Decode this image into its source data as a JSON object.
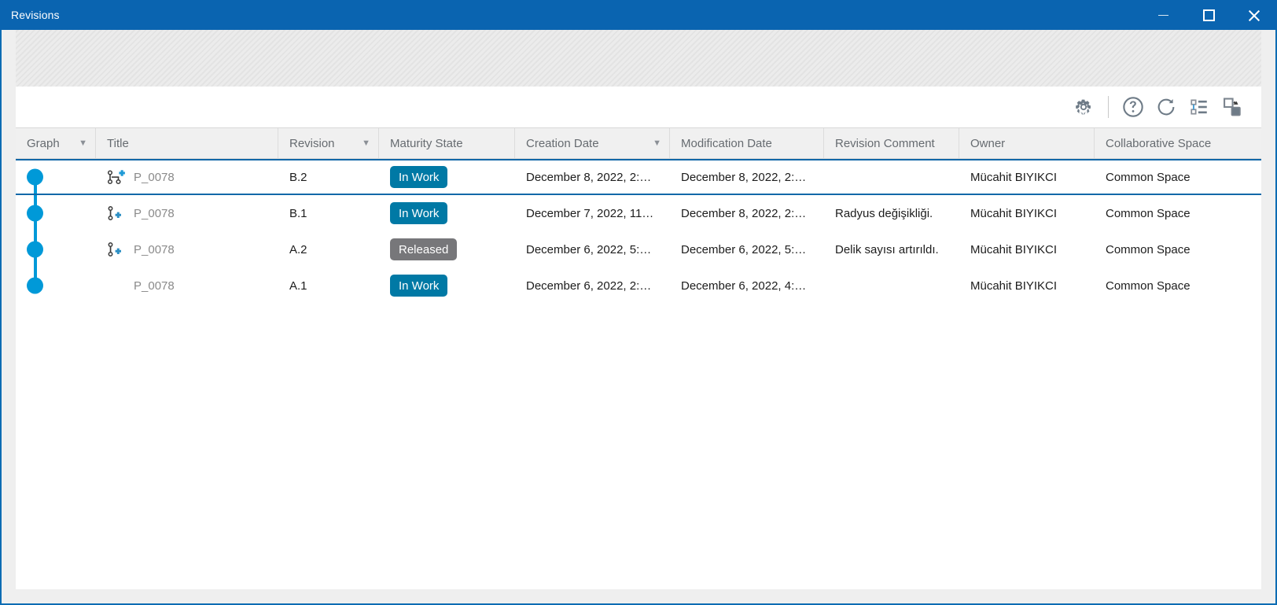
{
  "window": {
    "title": "Revisions",
    "controls": {
      "minimize": "minimize-button",
      "maximize": "maximize-button",
      "close": "close-button"
    },
    "accent_color": "#0a64b0",
    "selection_border_color": "#1268a8"
  },
  "toolbar": {
    "buttons": [
      {
        "name": "settings-icon",
        "tooltip": "Settings"
      },
      {
        "name": "help-icon",
        "tooltip": "Help"
      },
      {
        "name": "refresh-icon",
        "tooltip": "Refresh"
      },
      {
        "name": "tree-list-icon",
        "tooltip": "Tree View"
      },
      {
        "name": "restore-down-icon",
        "tooltip": "Restore Down"
      }
    ]
  },
  "table": {
    "columns": [
      {
        "key": "graph",
        "label": "Graph",
        "sort": "▼"
      },
      {
        "key": "title",
        "label": "Title",
        "sort": ""
      },
      {
        "key": "revision",
        "label": "Revision",
        "sort": "▼"
      },
      {
        "key": "maturity",
        "label": "Maturity State",
        "sort": ""
      },
      {
        "key": "created",
        "label": "Creation Date",
        "sort": "▼"
      },
      {
        "key": "modified",
        "label": "Modification Date",
        "sort": ""
      },
      {
        "key": "comment",
        "label": "Revision Comment",
        "sort": ""
      },
      {
        "key": "owner",
        "label": "Owner",
        "sort": ""
      },
      {
        "key": "space",
        "label": "Collaborative Space",
        "sort": ""
      }
    ],
    "rows": [
      {
        "selected": true,
        "graph": {
          "dot": true,
          "line_up": false,
          "line_down": true
        },
        "icon": "revision-branch-add-icon",
        "title": "P_0078",
        "revision": "B.2",
        "maturity": "In Work",
        "maturity_style": "inwork",
        "created": "December 8, 2022, 2:…",
        "modified": "December 8, 2022, 2:…",
        "comment": "",
        "owner": "Mücahit BIYIKCI",
        "space": "Common  Space"
      },
      {
        "selected": false,
        "graph": {
          "dot": true,
          "line_up": true,
          "line_down": true
        },
        "icon": "revision-link-add-icon",
        "title": "P_0078",
        "revision": "B.1",
        "maturity": "In Work",
        "maturity_style": "inwork",
        "created": "December 7, 2022, 11…",
        "modified": "December 8, 2022, 2:…",
        "comment": "Radyus değişikliği.",
        "owner": "Mücahit BIYIKCI",
        "space": "Common  Space"
      },
      {
        "selected": false,
        "graph": {
          "dot": true,
          "line_up": true,
          "line_down": true
        },
        "icon": "revision-link-add-icon",
        "title": "P_0078",
        "revision": "A.2",
        "maturity": "Released",
        "maturity_style": "released",
        "created": "December 6, 2022, 5:…",
        "modified": "December 6, 2022, 5:…",
        "comment": "Delik sayısı artırıldı.",
        "owner": "Mücahit BIYIKCI",
        "space": "Common  Space"
      },
      {
        "selected": false,
        "graph": {
          "dot": true,
          "line_up": true,
          "line_down": false
        },
        "icon": "none",
        "title": "P_0078",
        "revision": "A.1",
        "maturity": "In Work",
        "maturity_style": "inwork",
        "created": "December 6, 2022, 2:…",
        "modified": "December 6, 2022, 4:…",
        "comment": "",
        "owner": "Mücahit BIYIKCI",
        "space": "Common  Space"
      }
    ]
  },
  "colors": {
    "graph_node": "#0099d8",
    "badge_inwork": "#0079a5",
    "badge_released": "#77777a",
    "header_bg": "#f0f0f0"
  }
}
